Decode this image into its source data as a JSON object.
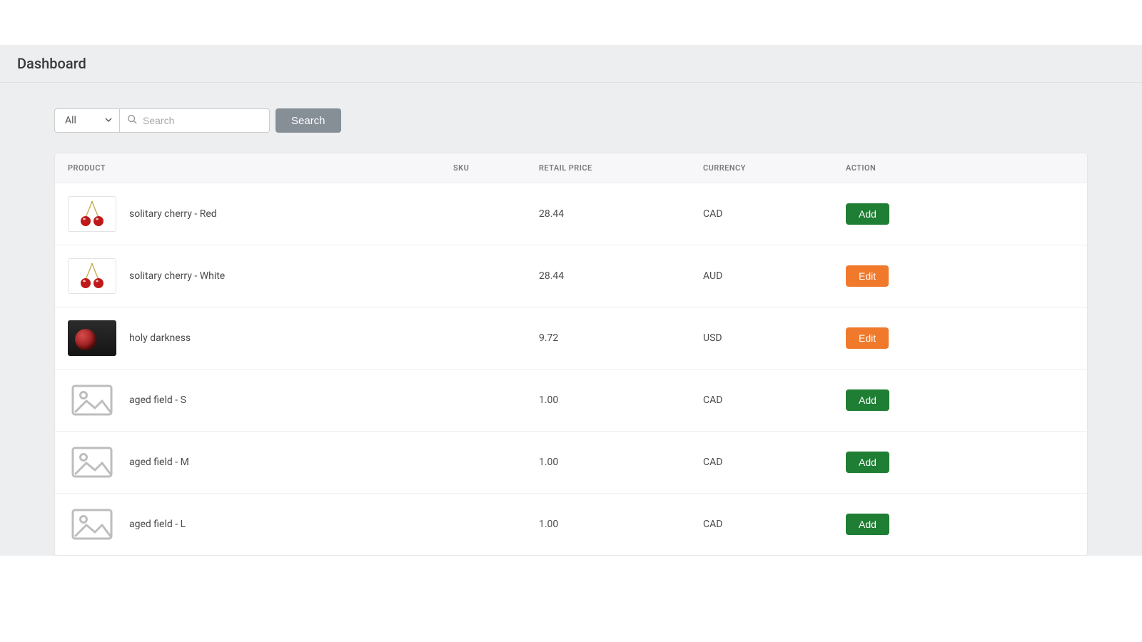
{
  "header": {
    "title": "Dashboard"
  },
  "filter": {
    "selected": "All",
    "search_placeholder": "Search",
    "search_value": "",
    "search_button": "Search"
  },
  "table": {
    "columns": {
      "product": "Product",
      "sku": "SKU",
      "retail_price": "Retail Price",
      "currency": "Currency",
      "action": "Action"
    },
    "action_labels": {
      "add": "Add",
      "edit": "Edit"
    },
    "rows": [
      {
        "name": "solitary cherry - Red",
        "sku": "",
        "price": "28.44",
        "currency": "CAD",
        "action": "add",
        "thumb": "cherry"
      },
      {
        "name": "solitary cherry - White",
        "sku": "",
        "price": "28.44",
        "currency": "AUD",
        "action": "edit",
        "thumb": "cherry"
      },
      {
        "name": "holy darkness",
        "sku": "",
        "price": "9.72",
        "currency": "USD",
        "action": "edit",
        "thumb": "dark"
      },
      {
        "name": "aged field - S",
        "sku": "",
        "price": "1.00",
        "currency": "CAD",
        "action": "add",
        "thumb": "placeholder"
      },
      {
        "name": "aged field - M",
        "sku": "",
        "price": "1.00",
        "currency": "CAD",
        "action": "add",
        "thumb": "placeholder"
      },
      {
        "name": "aged field - L",
        "sku": "",
        "price": "1.00",
        "currency": "CAD",
        "action": "add",
        "thumb": "placeholder"
      }
    ]
  }
}
